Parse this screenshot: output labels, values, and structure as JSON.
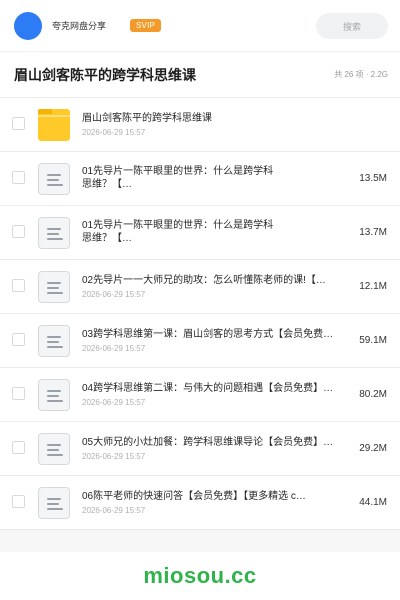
{
  "header": {
    "app_name": "夸克网盘分享",
    "badge": "SVIP",
    "search_placeholder": "搜索",
    "accent_color": "#2d7cf6",
    "badge_color": "#f39b2a"
  },
  "folder": {
    "title": "眉山剑客陈平的跨学科思维课",
    "meta": "共 26 项 · 2.2G"
  },
  "files": [
    {
      "name": "眉山剑客陈平的跨学科思维课",
      "date": "2026-06-29 15:57",
      "size": "",
      "icon": "folder-icon"
    },
    {
      "name": "01先导片一陈平眼里的世界：什么是跨学科思维？【…",
      "date": "2026-06-29 15:57",
      "size": "13.5M",
      "icon": "doc-icon"
    },
    {
      "name": "01先导片一陈平眼里的世界：什么是跨学科思维？【…",
      "date": "2026-06-29 15:57",
      "size": "13.7M",
      "icon": "doc-icon"
    },
    {
      "name": "02先导片一一大师兄的助攻：怎么听懂陈老师的课!【…",
      "date": "2026-06-29 15:57",
      "size": "12.1M",
      "icon": "doc-icon"
    },
    {
      "name": "03跨学科思维第一课：眉山剑客的思考方式【会员免费…",
      "date": "2026-06-29 15:57",
      "size": "59.1M",
      "icon": "doc-icon"
    },
    {
      "name": "04跨学科思维第二课：与伟大的问题相遇【会员免费】…",
      "date": "2026-06-29 15:57",
      "size": "80.2M",
      "icon": "doc-icon"
    },
    {
      "name": "05大师兄的小灶加餐：跨学科思维课导论【会员免费】…",
      "date": "2026-06-29 15:57",
      "size": "29.2M",
      "icon": "doc-icon"
    },
    {
      "name": "06陈平老师的快速问答【会员免费】【更多精选 c…",
      "date": "2026-06-29 15:57",
      "size": "44.1M",
      "icon": "doc-icon"
    }
  ],
  "watermark": "miosou.cc"
}
